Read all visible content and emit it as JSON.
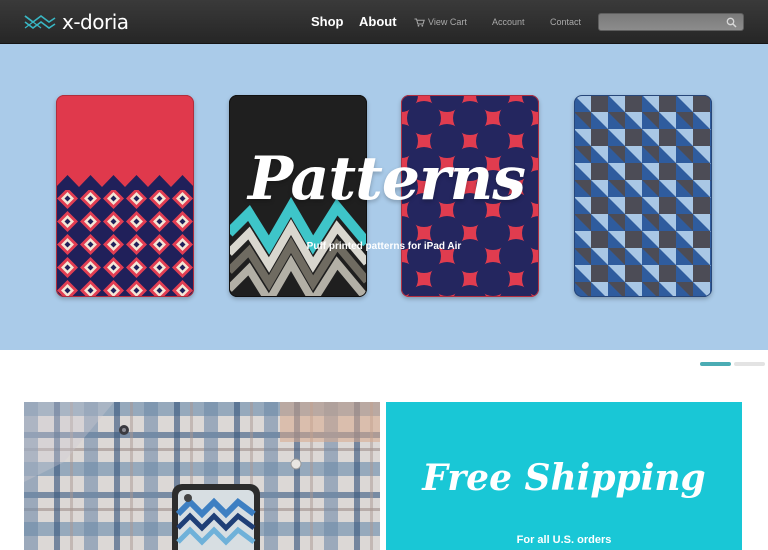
{
  "header": {
    "logo_text": "x-doria",
    "nav": {
      "shop": "Shop",
      "about": "About",
      "view_cart": "View Cart",
      "account": "Account",
      "contact": "Contact"
    },
    "search": {
      "value": "",
      "placeholder": ""
    }
  },
  "hero": {
    "title": "Patterns",
    "subtitle": "Puff printed patterns for iPad Air",
    "slides_total": 2,
    "active_slide": 1
  },
  "promos": {
    "shipping_title": "Free Shipping",
    "shipping_subtitle": "For all U.S. orders"
  },
  "colors": {
    "header_bg": "#2f2f2f",
    "hero_bg": "#aacbe9",
    "accent_teal": "#4bacb4",
    "shipping_bg": "#19c7d6",
    "logo_teal": "#39b6c3"
  },
  "icons": {
    "logo": "xdoria-logo-icon",
    "cart": "cart-icon",
    "search": "search-icon"
  }
}
